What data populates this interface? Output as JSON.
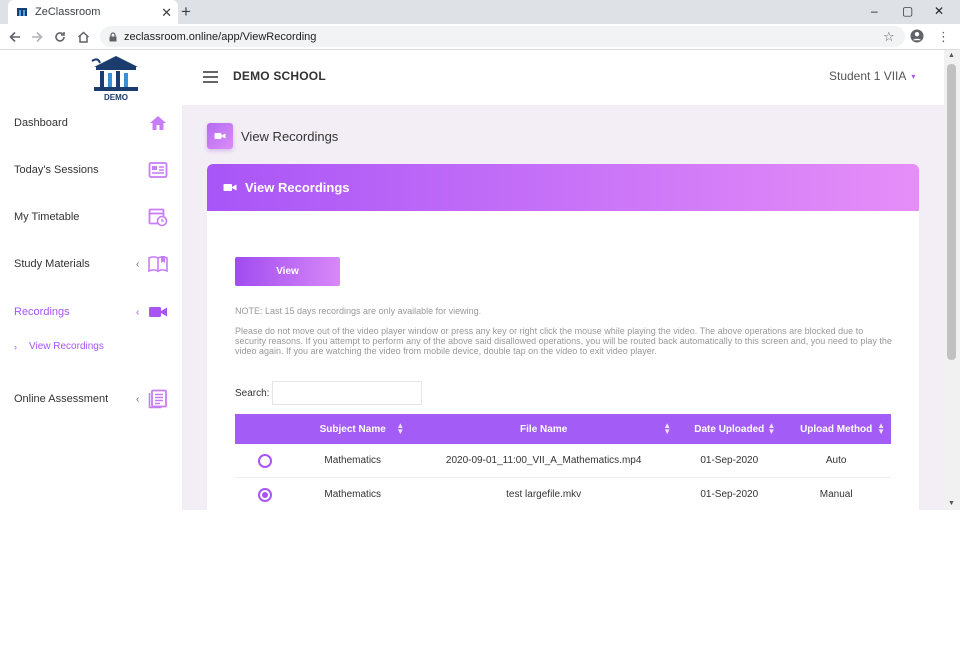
{
  "browser": {
    "tab_title": "ZeClassroom",
    "tab_close": "✕",
    "new_tab": "+",
    "url": "zeclassroom.online/app/ViewRecording",
    "window_controls": [
      "–",
      "▢",
      "✕"
    ]
  },
  "header": {
    "logo_text": "DEMO",
    "school_name": "DEMO SCHOOL",
    "user_name": "Student 1 VIIA",
    "caret": "▾"
  },
  "sidebar": {
    "items": [
      {
        "label": "Dashboard",
        "icon": "home-icon",
        "chevron": ""
      },
      {
        "label": "Today's Sessions",
        "icon": "sessions-icon",
        "chevron": ""
      },
      {
        "label": "My Timetable",
        "icon": "timetable-icon",
        "chevron": ""
      },
      {
        "label": "Study Materials",
        "icon": "book-icon",
        "chevron": "‹"
      },
      {
        "label": "Recordings",
        "icon": "video-icon",
        "chevron": "‹"
      },
      {
        "label": "Online Assessment",
        "icon": "assessment-icon",
        "chevron": "‹"
      }
    ],
    "sub_item": {
      "arrow": "›",
      "label": "View Recordings"
    }
  },
  "main": {
    "page_title": "View Recordings",
    "card_title": "View Recordings",
    "view_button": "View",
    "note1": "NOTE: Last 15 days recordings are only available for viewing.",
    "note2": "Please do not move out of the video player window or press any key or right click the mouse while playing the video. The above operations are blocked due to security reasons. If you attempt to perform any of the above said disallowed operations, you will be routed back automatically to this screen and, you need to play the video again. If you are watching the video from mobile device, double tap on the video to exit video player.",
    "search_label": "Search:",
    "search_value": "",
    "table": {
      "headers": [
        "",
        "Subject Name",
        "File Name",
        "Date Uploaded",
        "Upload Method"
      ],
      "rows": [
        {
          "selected": false,
          "subject": "Mathematics",
          "file": "2020-09-01_11:00_VII_A_Mathematics.mp4",
          "date": "01-Sep-2020",
          "method": "Auto"
        },
        {
          "selected": true,
          "subject": "Mathematics",
          "file": "test largefile.mkv",
          "date": "01-Sep-2020",
          "method": "Manual"
        }
      ]
    }
  },
  "colors": {
    "accent": "#a855f7",
    "header_gradient_end": "#e68ef8",
    "main_bg": "#f3eef6"
  }
}
